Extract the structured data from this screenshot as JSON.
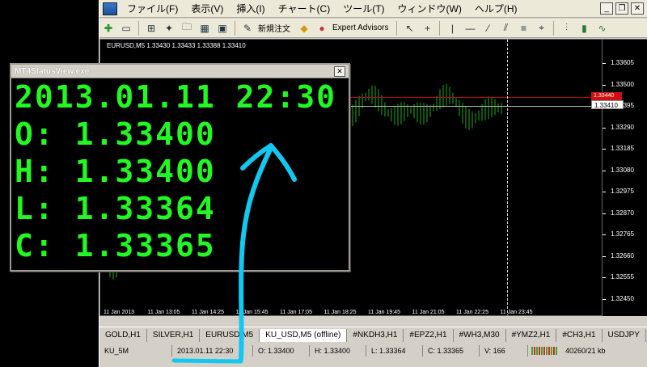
{
  "menu": {
    "items": [
      "ファイル(F)",
      "表示(V)",
      "挿入(I)",
      "チャート(C)",
      "ツール(T)",
      "ウィンドウ(W)",
      "ヘルプ(H)"
    ],
    "minimize": "_",
    "restore": "❐",
    "close": "✕"
  },
  "toolbar": {
    "new_order": "新規注文",
    "expert_advisors": "Expert Advisors"
  },
  "chart": {
    "title": "EURUSD,M5  1.33430 1.33433 1.33388 1.33410",
    "price_ticks": [
      "1.33605",
      "1.33500",
      "1.33395",
      "1.33290",
      "1.33185",
      "1.33080",
      "1.32975",
      "1.32870",
      "1.32765",
      "1.32660",
      "1.32555",
      "1.32450"
    ],
    "red_price": "1.33440",
    "bid_price": "1.33410",
    "time_ticks": [
      "11 Jan 2013",
      "11 Jan 13:05",
      "11 Jan 14:25",
      "11 Jan 15:45",
      "11 Jan 17:05",
      "11 Jan 18:25",
      "11 Jan 19:45",
      "11 Jan 21:05",
      "11 Jan 22:25",
      "11 Jan 23:45"
    ],
    "colors": {
      "candle": "#1fa81f",
      "background": "#000000",
      "red_line": "#b81414"
    }
  },
  "tabs": [
    "GOLD,H1",
    "SILVER,H1",
    "EURUSD,M5",
    "KU_USD,M5 (offline)",
    "#NKDH3,H1",
    "#EPZ2,H1",
    "#WH3,M30",
    "#YMZ2,H1",
    "#CH3,H1",
    "USDJPY"
  ],
  "active_tab": 3,
  "statusbar": {
    "profile": "KU_5M",
    "datetime": "2013.01.11 22:30",
    "open": "O: 1.33400",
    "high": "H: 1.33400",
    "low": "L: 1.33364",
    "close": "C: 1.33365",
    "volume": "V: 166",
    "traffic": "40260/21 kb"
  },
  "status_view": {
    "title": "MT4StatusView.exe",
    "close": "✕",
    "datetime": "2013.01.11 22:30",
    "open": "O: 1.33400",
    "high": "H: 1.33400",
    "low": "L: 1.33364",
    "close_price": "C: 1.33365",
    "text_color": "#22f822"
  },
  "annotation_color": "#12c8f0"
}
